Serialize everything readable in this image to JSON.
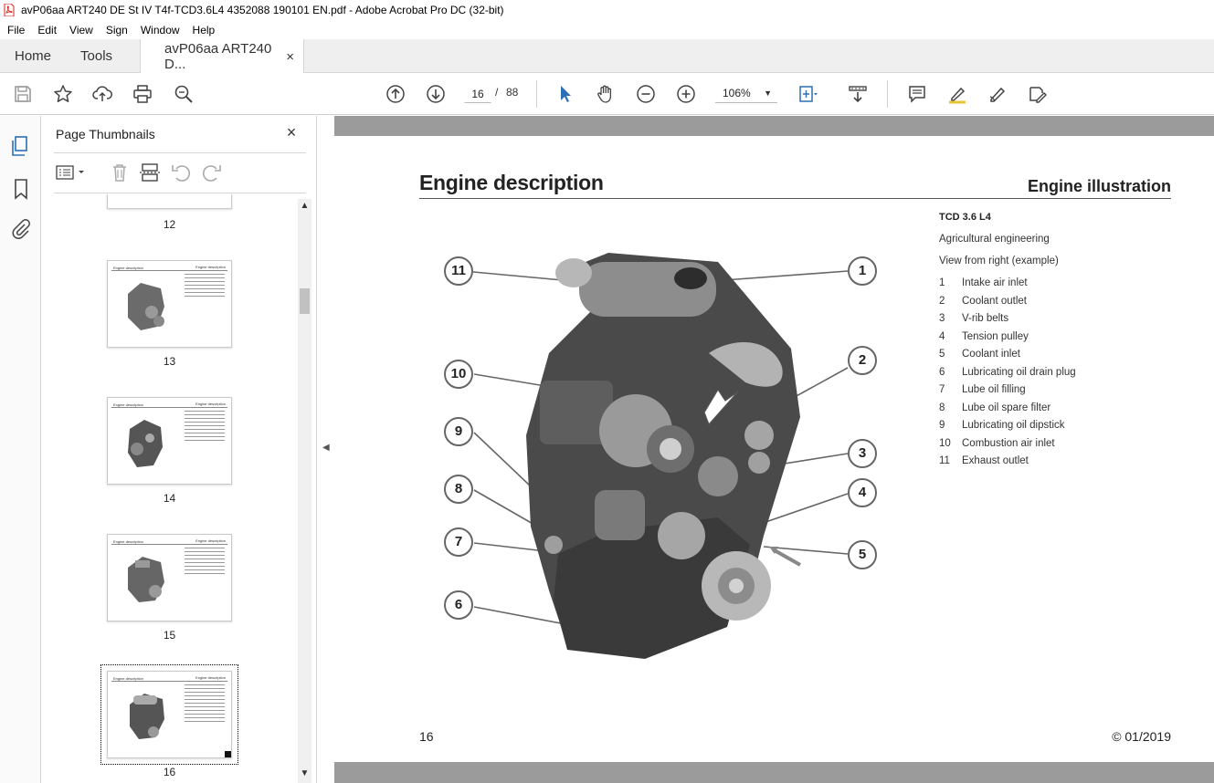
{
  "window": {
    "title": "avP06aa ART240 DE St IV T4f-TCD3.6L4 4352088 190101 EN.pdf - Adobe Acrobat Pro DC (32-bit)"
  },
  "menu": [
    "File",
    "Edit",
    "View",
    "Sign",
    "Window",
    "Help"
  ],
  "tabs": {
    "home": "Home",
    "tools": "Tools",
    "document": "avP06aa ART240 D...",
    "close_glyph": "×"
  },
  "toolbar": {
    "current_page": "16",
    "page_separator": "/",
    "total_pages": "88",
    "zoom": "106%"
  },
  "thumbnails_panel": {
    "title": "Page Thumbnails",
    "close_glyph": "×",
    "pages": [
      {
        "number": "12"
      },
      {
        "number": "13",
        "heading": "Engine description",
        "heading_right": "Engine description"
      },
      {
        "number": "14",
        "heading": "Engine description",
        "heading_right": "Engine description"
      },
      {
        "number": "15",
        "heading": "Engine description",
        "heading_right": "Engine description"
      },
      {
        "number": "16",
        "heading": "Engine description",
        "heading_right": "Engine description",
        "selected": true
      }
    ]
  },
  "document": {
    "heading": "Engine description",
    "heading_right": "Engine illustration",
    "model": "TCD 3.6 L4",
    "subtitle_1": "Agricultural engineering",
    "subtitle_2": "View from right (example)",
    "legend": [
      {
        "n": "1",
        "label": "Intake air inlet"
      },
      {
        "n": "2",
        "label": "Coolant outlet"
      },
      {
        "n": "3",
        "label": "V-rib belts"
      },
      {
        "n": "4",
        "label": "Tension pulley"
      },
      {
        "n": "5",
        "label": "Coolant inlet"
      },
      {
        "n": "6",
        "label": "Lubricating oil drain plug"
      },
      {
        "n": "7",
        "label": "Lube oil filling"
      },
      {
        "n": "8",
        "label": "Lube oil spare filter"
      },
      {
        "n": "9",
        "label": "Lubricating oil dipstick"
      },
      {
        "n": "10",
        "label": "Combustion air inlet"
      },
      {
        "n": "11",
        "label": "Exhaust outlet"
      }
    ],
    "callouts": [
      "11",
      "1",
      "10",
      "2",
      "9",
      "3",
      "8",
      "4",
      "7",
      "5",
      "6"
    ],
    "page_number": "16",
    "copyright": "© 01/2019"
  },
  "icons": {
    "save": "save-icon",
    "bookmark": "star-icon",
    "upload": "upload-icon",
    "print": "print-icon",
    "find": "magnify-icon",
    "prev": "arrow-up-circle-icon",
    "next": "arrow-down-circle-icon",
    "select": "pointer-icon",
    "hand": "hand-icon",
    "zoom_out": "zoom-out-icon",
    "zoom_in": "zoom-in-icon"
  },
  "colors": {
    "accent": "#2c6fb5",
    "pdf_red": "#d9241c",
    "doc_band": "#9b9b9b"
  }
}
